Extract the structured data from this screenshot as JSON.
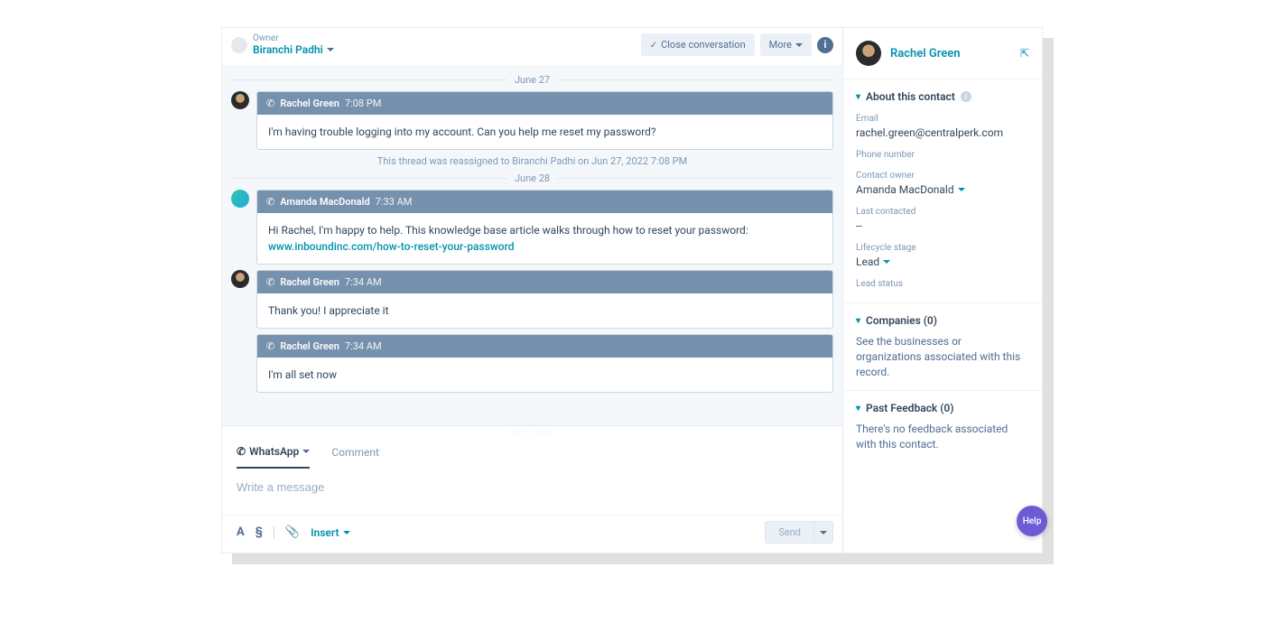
{
  "header": {
    "owner_label": "Owner",
    "owner_name": "Biranchi Padhi",
    "close_label": "Close conversation",
    "more_label": "More"
  },
  "conversation": {
    "date1": "June 27",
    "date2": "June 28",
    "system_note": "This thread was reassigned to Biranchi Padhi on Jun 27, 2022 7:08 PM",
    "messages": [
      {
        "sender": "Rachel Green",
        "time": "7:08 PM",
        "body": "I'm having trouble logging into my account. Can you help me reset my password?"
      },
      {
        "sender": "Amanda MacDonald",
        "time": "7:33 AM",
        "body_prefix": "Hi Rachel, I'm happy to help. This knowledge base article walks through how to reset your password: ",
        "link": "www.inboundinc.com/how-to-reset-your-password"
      },
      {
        "sender": "Rachel Green",
        "time": "7:34 AM",
        "body": "Thank you! I appreciate it"
      },
      {
        "sender": "Rachel Green",
        "time": "7:34 AM",
        "body": "I'm all set now"
      }
    ]
  },
  "composer": {
    "tab_whatsapp": "WhatsApp",
    "tab_comment": "Comment",
    "placeholder": "Write a message",
    "insert_label": "Insert",
    "send_label": "Send"
  },
  "contact": {
    "name": "Rachel Green",
    "about_title": "About this contact",
    "email_label": "Email",
    "email_value": "rachel.green@centralperk.com",
    "phone_label": "Phone number",
    "owner_label": "Contact owner",
    "owner_value": "Amanda MacDonald",
    "last_contacted_label": "Last contacted",
    "last_contacted_value": "--",
    "lifecycle_label": "Lifecycle stage",
    "lifecycle_value": "Lead",
    "lead_status_label": "Lead status",
    "companies_title": "Companies (0)",
    "companies_text": "See the businesses or organizations associated with this record.",
    "feedback_title": "Past Feedback (0)",
    "feedback_text": "There's no feedback associated with this contact.",
    "help_label": "Help"
  }
}
